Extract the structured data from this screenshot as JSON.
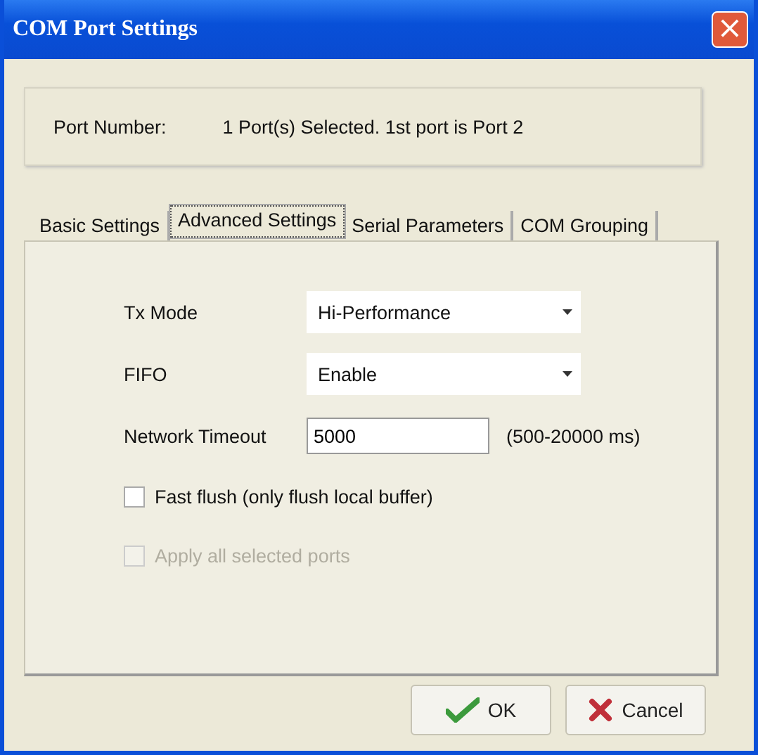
{
  "window": {
    "title": "COM Port Settings",
    "close": "×"
  },
  "port": {
    "label": "Port Number:",
    "value": "1 Port(s) Selected. 1st port is Port 2"
  },
  "tabs": [
    {
      "label": "Basic Settings",
      "selected": false
    },
    {
      "label": "Advanced Settings",
      "selected": true
    },
    {
      "label": "Serial Parameters",
      "selected": false
    },
    {
      "label": "COM Grouping",
      "selected": false
    }
  ],
  "fields": [
    {
      "kind": "dropdown",
      "label": "Tx Mode",
      "value": "Hi-Performance"
    },
    {
      "kind": "dropdown",
      "label": "FIFO",
      "value": "Enable"
    },
    {
      "kind": "input",
      "label": "Network Timeout",
      "value": "5000",
      "hint": "(500-20000 ms)"
    }
  ],
  "checkboxes": [
    {
      "label": "Fast flush (only flush local buffer)",
      "checked": false,
      "disabled": false
    },
    {
      "label": "Apply all selected ports",
      "checked": false,
      "disabled": true
    }
  ],
  "buttons": [
    {
      "kind": "ok",
      "label": "OK"
    },
    {
      "kind": "cancel",
      "label": "Cancel"
    }
  ]
}
